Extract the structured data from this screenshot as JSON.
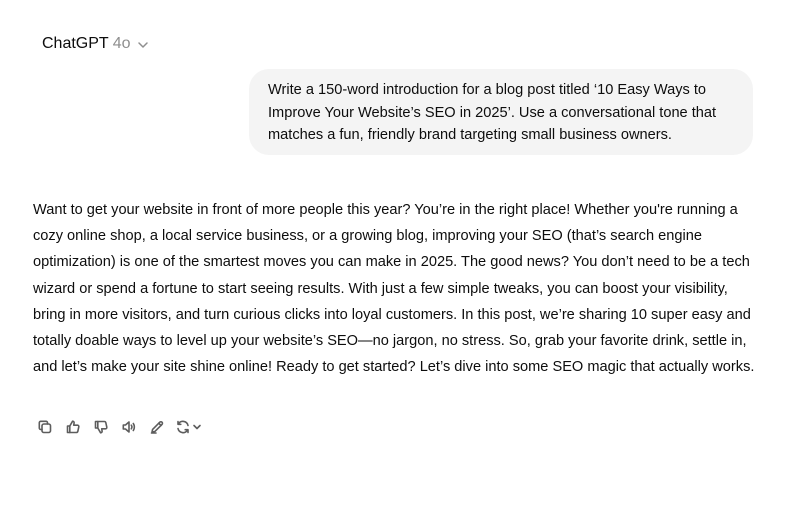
{
  "header": {
    "model_name": "ChatGPT",
    "model_version": "4o"
  },
  "conversation": {
    "user_message": "Write a 150-word introduction for a blog post titled ‘10 Easy Ways to Improve Your Website’s SEO in 2025’. Use a conversational tone that matches a fun, friendly brand targeting small business owners.",
    "assistant_message": "Want to get your website in front of more people this year? You’re in the right place! Whether you're running a cozy online shop, a local service business, or a growing blog, improving your SEO (that’s search engine optimization) is one of the smartest moves you can make in 2025. The good news? You don’t need to be a tech wizard or spend a fortune to start seeing results. With just a few simple tweaks, you can boost your visibility, bring in more visitors, and turn curious clicks into loyal customers. In this post, we’re sharing 10 super easy and totally doable ways to level up your website’s SEO—no jargon, no stress. So, grab your favorite drink, settle in, and let’s make your site shine online! Ready to get started? Let’s dive into some SEO magic that actually works."
  },
  "actions": [
    {
      "icon": "copy-icon"
    },
    {
      "icon": "thumbs-up-icon"
    },
    {
      "icon": "thumbs-down-icon"
    },
    {
      "icon": "read-aloud-icon"
    },
    {
      "icon": "edit-icon"
    },
    {
      "icon": "regenerate-icon"
    }
  ]
}
